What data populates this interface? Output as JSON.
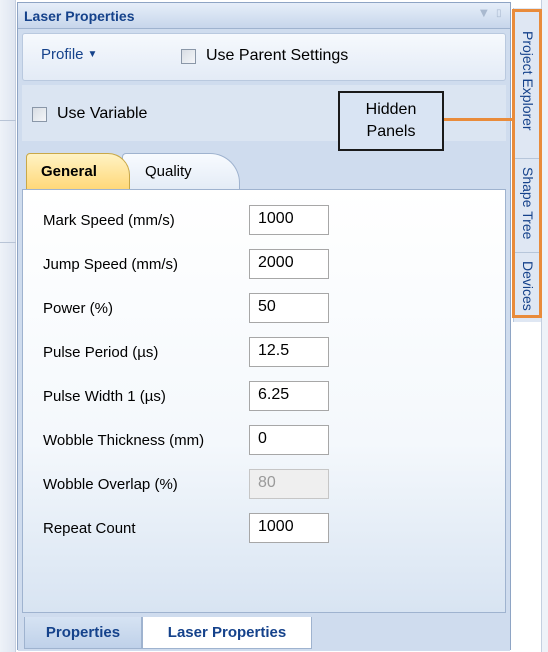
{
  "panel": {
    "title": "Laser Properties"
  },
  "toolbar": {
    "profile_label": "Profile",
    "use_parent_settings_label": "Use Parent Settings"
  },
  "variable": {
    "use_variable_label": "Use Variable"
  },
  "tabs": [
    {
      "label": "General",
      "active": true
    },
    {
      "label": "Quality",
      "active": false
    }
  ],
  "fields": [
    {
      "label": "Mark Speed (mm/s)",
      "value": "1000",
      "enabled": true
    },
    {
      "label": "Jump Speed (mm/s)",
      "value": "2000",
      "enabled": true
    },
    {
      "label": "Power (%)",
      "value": "50",
      "enabled": true
    },
    {
      "label": "Pulse Period (µs)",
      "value": "12.5",
      "enabled": true
    },
    {
      "label": "Pulse Width 1 (µs)",
      "value": "6.25",
      "enabled": true
    },
    {
      "label": "Wobble Thickness (mm)",
      "value": "0",
      "enabled": true
    },
    {
      "label": "Wobble Overlap (%)",
      "value": "80",
      "enabled": false
    },
    {
      "label": "Repeat Count",
      "value": "1000",
      "enabled": true
    }
  ],
  "bottom_tabs": [
    {
      "label": "Properties",
      "active": false
    },
    {
      "label": "Laser Properties",
      "active": true
    }
  ],
  "side_tabs": [
    {
      "label": "Project Explorer"
    },
    {
      "label": "Shape Tree"
    },
    {
      "label": "Devices"
    }
  ],
  "callout": {
    "text": "Hidden Panels"
  },
  "colors": {
    "title_text": "#15428b",
    "active_tab": "#ffd879",
    "highlight": "#e98b3a",
    "panel_bg": "#cfdcee"
  }
}
